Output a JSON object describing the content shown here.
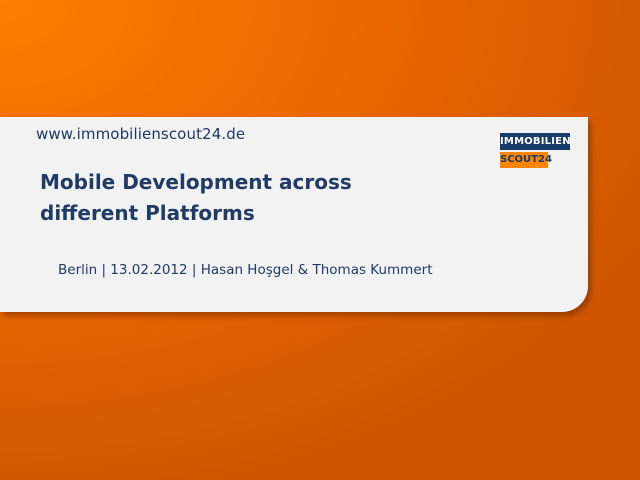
{
  "slide": {
    "url": "www.immobilienscout24.de",
    "title_line1": "Mobile Development across",
    "title_line2": "different Platforms",
    "subtitle": "Berlin | 13.02.2012 | Hasan Hoşgel & Thomas Kummert"
  },
  "logo": {
    "top_text": "IMMOBILIEN",
    "bottom_text": "SCOUT24"
  },
  "colors": {
    "background": "#ff7e00",
    "card": "#f2f2f2",
    "text": "#1f3b66",
    "logo_navy": "#173b6a",
    "logo_orange": "#ff8400"
  }
}
